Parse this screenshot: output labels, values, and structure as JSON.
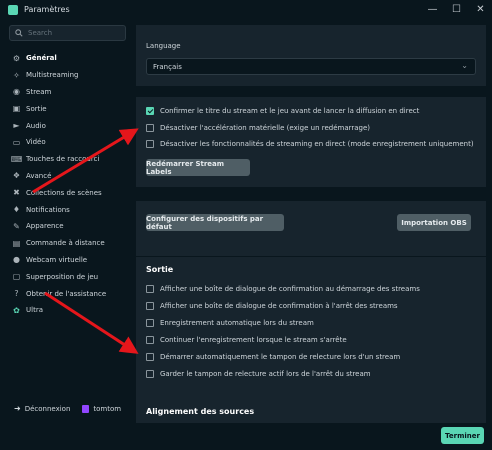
{
  "window": {
    "title": "Paramètres",
    "controls": [
      "minimize",
      "maximize",
      "close"
    ]
  },
  "sidebar": {
    "search_placeholder": "Search",
    "items": [
      {
        "label": "Général",
        "icon": "gear-icon",
        "active": true
      },
      {
        "label": "Multistreaming",
        "icon": "multistream-icon"
      },
      {
        "label": "Stream",
        "icon": "globe-icon"
      },
      {
        "label": "Sortie",
        "icon": "output-icon"
      },
      {
        "label": "Audio",
        "icon": "speaker-icon"
      },
      {
        "label": "Vidéo",
        "icon": "display-icon"
      },
      {
        "label": "Touches de raccourci",
        "icon": "keyboard-icon"
      },
      {
        "label": "Avancé",
        "icon": "advanced-icon"
      },
      {
        "label": "Collections de scènes",
        "icon": "collections-icon"
      },
      {
        "label": "Notifications",
        "icon": "bell-icon"
      },
      {
        "label": "Apparence",
        "icon": "paint-icon"
      },
      {
        "label": "Commande à distance",
        "icon": "remote-icon"
      },
      {
        "label": "Webcam virtuelle",
        "icon": "webcam-icon"
      },
      {
        "label": "Superposition de jeu",
        "icon": "overlay-icon"
      },
      {
        "label": "Obtenir de l'assistance",
        "icon": "help-icon"
      },
      {
        "label": "Ultra",
        "icon": "ultra-icon"
      }
    ],
    "account": {
      "logout_label": "Déconnexion",
      "username": "tomtom"
    }
  },
  "language_panel": {
    "label": "Language",
    "selected": "Français"
  },
  "stream_panel": {
    "checkboxes": [
      {
        "label": "Confirmer le titre du stream et le jeu avant de lancer la diffusion en direct",
        "checked": true
      },
      {
        "label": "Désactiver l'accélération matérielle (exige un redémarrage)",
        "checked": false
      },
      {
        "label": "Désactiver les fonctionnalités de streaming en direct (mode enregistrement uniquement)",
        "checked": false
      }
    ],
    "restart_button": "Redémarrer Stream Labels"
  },
  "devices_panel": {
    "configure_button": "Configurer des dispositifs par défaut",
    "import_button": "Importation OBS"
  },
  "output_panel": {
    "title": "Sortie",
    "checkboxes": [
      {
        "label": "Afficher une boîte de dialogue de confirmation au démarrage des streams",
        "checked": false
      },
      {
        "label": "Afficher une boîte de dialogue de confirmation à l'arrêt des streams",
        "checked": false
      },
      {
        "label": "Enregistrement automatique lors du stream",
        "checked": false
      },
      {
        "label": "Continuer l'enregistrement lorsque le stream s'arrête",
        "checked": false
      },
      {
        "label": "Démarrer automatiquement le tampon de relecture lors d'un stream",
        "checked": false
      },
      {
        "label": "Garder le tampon de relecture actif lors de l'arrêt du stream",
        "checked": false
      }
    ]
  },
  "alignment_panel": {
    "title": "Alignement des sources"
  },
  "footer": {
    "done_button": "Terminer"
  },
  "colors": {
    "accent": "#5ad6b4",
    "background": "#09161d",
    "panel": "#17242d",
    "annotation_arrow": "#e5161b"
  }
}
